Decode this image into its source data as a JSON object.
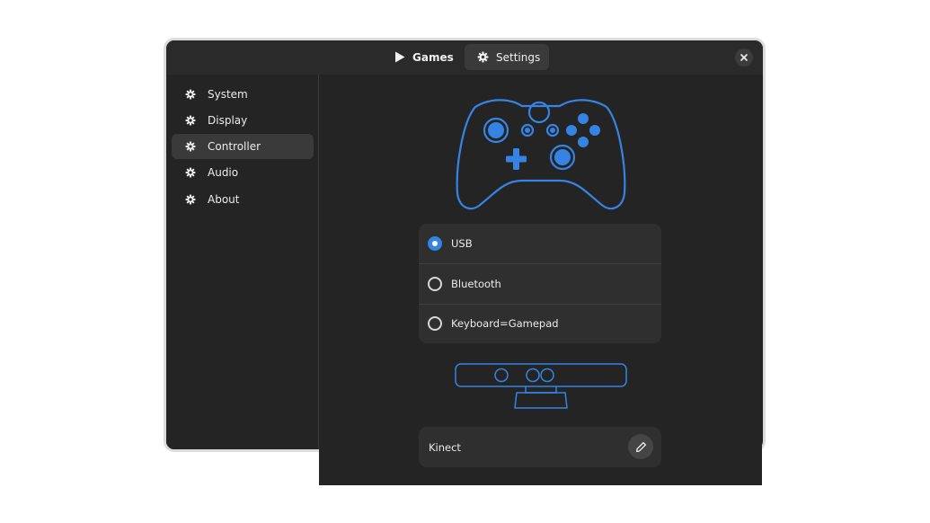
{
  "header": {
    "tabs": [
      {
        "label": "Games",
        "icon": "play-icon"
      },
      {
        "label": "Settings",
        "icon": "gear-icon"
      }
    ],
    "close_icon": "close-icon"
  },
  "sidebar": {
    "items": [
      {
        "label": "System",
        "icon": "gear-icon"
      },
      {
        "label": "Display",
        "icon": "gear-icon"
      },
      {
        "label": "Controller",
        "icon": "gear-icon",
        "active": true
      },
      {
        "label": "Audio",
        "icon": "gear-icon"
      },
      {
        "label": "About",
        "icon": "gear-icon"
      }
    ]
  },
  "controller": {
    "options": [
      {
        "label": "USB",
        "selected": true
      },
      {
        "label": "Bluetooth",
        "selected": false
      },
      {
        "label": "Keyboard=Gamepad",
        "selected": false
      }
    ],
    "device": {
      "label": "Kinect",
      "edit_icon": "pencil-icon"
    }
  },
  "colors": {
    "accent": "#3584e4",
    "window_bg": "#242424",
    "card_bg": "#2f2f2f",
    "selected_bg": "#3a3a3a"
  }
}
